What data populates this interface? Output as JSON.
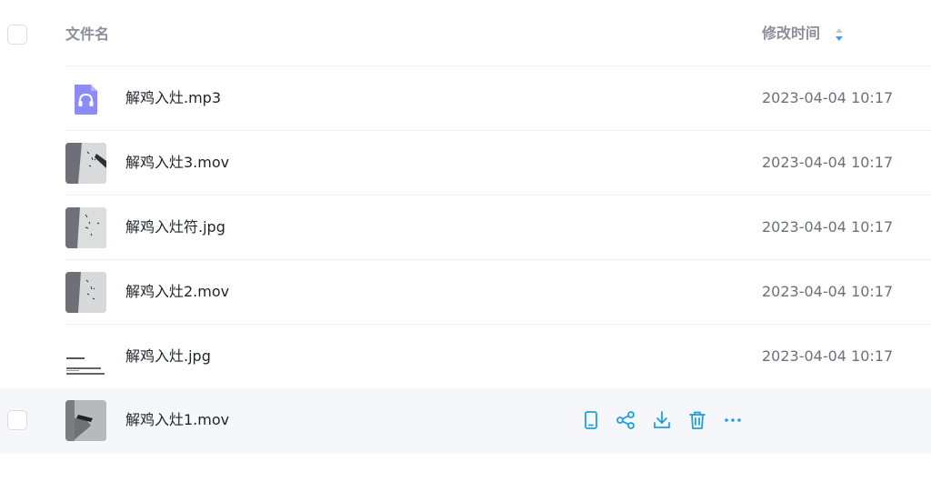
{
  "header": {
    "name_label": "文件名",
    "time_label": "修改时间"
  },
  "files": [
    {
      "name": "解鸡入灶.mp3",
      "modified": "2023-04-04 10:17",
      "kind": "audio"
    },
    {
      "name": "解鸡入灶3.mov",
      "modified": "2023-04-04 10:17",
      "kind": "video"
    },
    {
      "name": "解鸡入灶符.jpg",
      "modified": "2023-04-04 10:17",
      "kind": "image"
    },
    {
      "name": "解鸡入灶2.mov",
      "modified": "2023-04-04 10:17",
      "kind": "video"
    },
    {
      "name": "解鸡入灶.jpg",
      "modified": "2023-04-04 10:17",
      "kind": "document-image"
    },
    {
      "name": "解鸡入灶1.mov",
      "modified": "",
      "kind": "video"
    }
  ],
  "hover_actions": [
    "phone-icon",
    "share-icon",
    "download-icon",
    "delete-icon",
    "more-icon"
  ],
  "colors": {
    "accent": "#1e9fe0",
    "audio_icon": "#8b8cf7",
    "hover_row": "#f6f7fb",
    "sort_active": "#3aa0f5"
  }
}
